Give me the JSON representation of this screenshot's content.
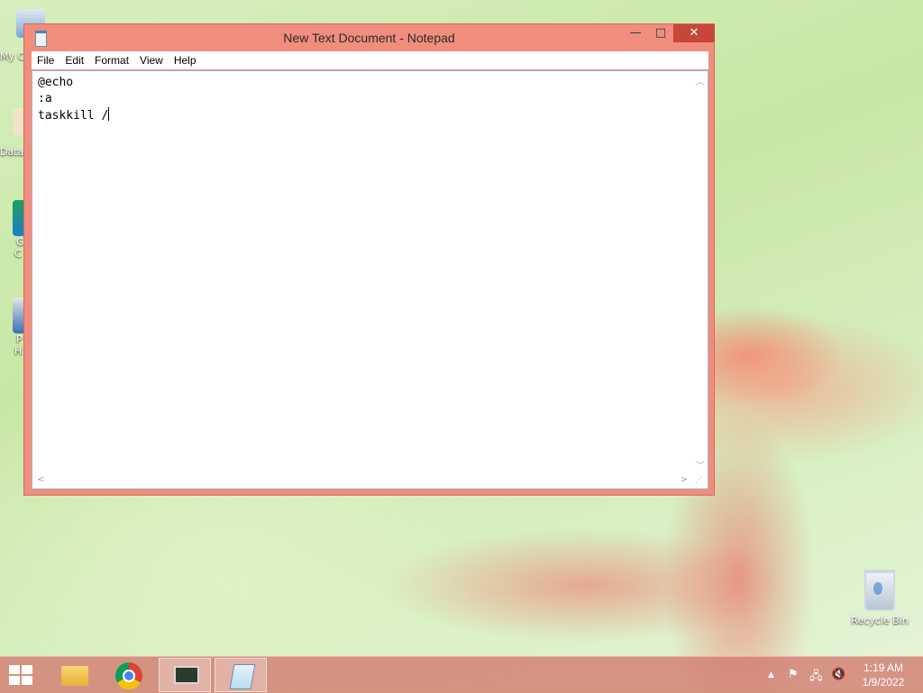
{
  "window": {
    "title": "New Text Document - Notepad",
    "controls": {
      "minimize": "—",
      "maximize": "□",
      "close": "✕"
    }
  },
  "menubar": {
    "items": [
      "File",
      "Edit",
      "Format",
      "View",
      "Help"
    ]
  },
  "editor": {
    "lines": [
      "@echo",
      ":a",
      "taskkill /"
    ]
  },
  "desktop": {
    "partial_labels": [
      "My C",
      "Data",
      "G",
      "C",
      "P",
      "H"
    ],
    "recycle_bin": "Recycle Bin"
  },
  "taskbar": {
    "apps": [
      "start-icon",
      "file-explorer-icon",
      "chrome-icon",
      "system-monitor-icon",
      "notepad-icon"
    ],
    "tray_icons": [
      "show-hidden-icon",
      "action-center-flag-icon",
      "network-icon",
      "volume-muted-icon"
    ],
    "clock": {
      "time": "1:19 AM",
      "date": "1/9/2022"
    }
  },
  "colors": {
    "window_frame": "#f08e7e",
    "close_button": "#c7463a",
    "taskbar": "#d2786e"
  }
}
